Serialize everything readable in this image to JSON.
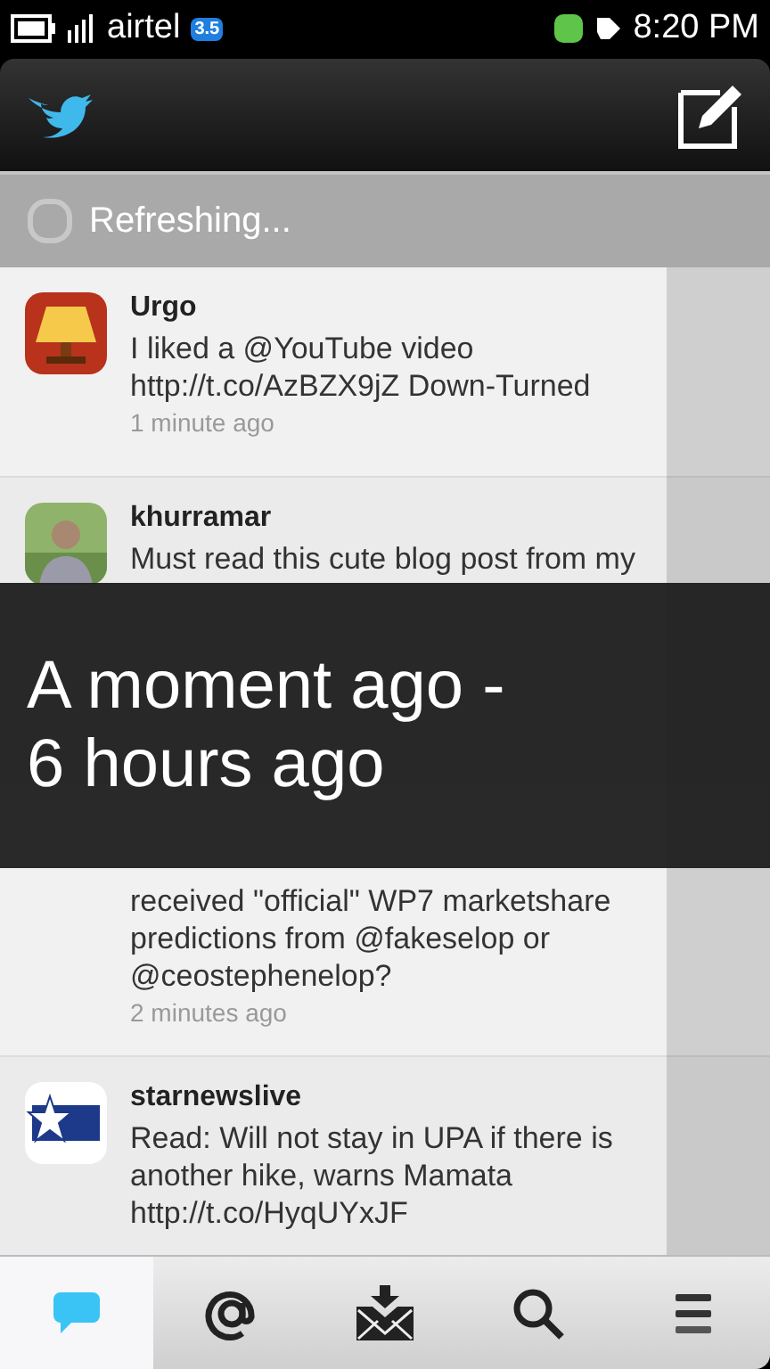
{
  "status_bar": {
    "carrier": "airtel",
    "network_badge": "3.5",
    "time": "8:20 PM"
  },
  "refresh": {
    "label": "Refreshing..."
  },
  "tweets": [
    {
      "kind": "lamp",
      "user": "Urgo",
      "text": "I liked a @YouTube video http://t.co/AzBZX9jZ Down-Turned",
      "time": "1 minute ago"
    },
    {
      "user": "khurramar",
      "text": "Must read this cute blog post from my"
    },
    {
      "kind": "covered",
      "text": "received \"official\" WP7 marketshare predictions from @fakeselop or @ceostephenelop?",
      "time": "2 minutes ago"
    },
    {
      "kind": "star",
      "user": "starnewslive",
      "text": "Read: Will not stay in UPA if there is another hike, warns Mamata http://t.co/HyqUYxJF"
    }
  ],
  "overlay": {
    "text": "A moment ago -\n6 hours ago"
  },
  "toolbar": [
    {
      "kind": "tweets",
      "selected": true
    },
    {
      "kind": "mentions",
      "selected": false
    },
    {
      "kind": "messages",
      "selected": false
    },
    {
      "kind": "search",
      "selected": false
    },
    {
      "kind": "menu",
      "selected": false
    }
  ]
}
